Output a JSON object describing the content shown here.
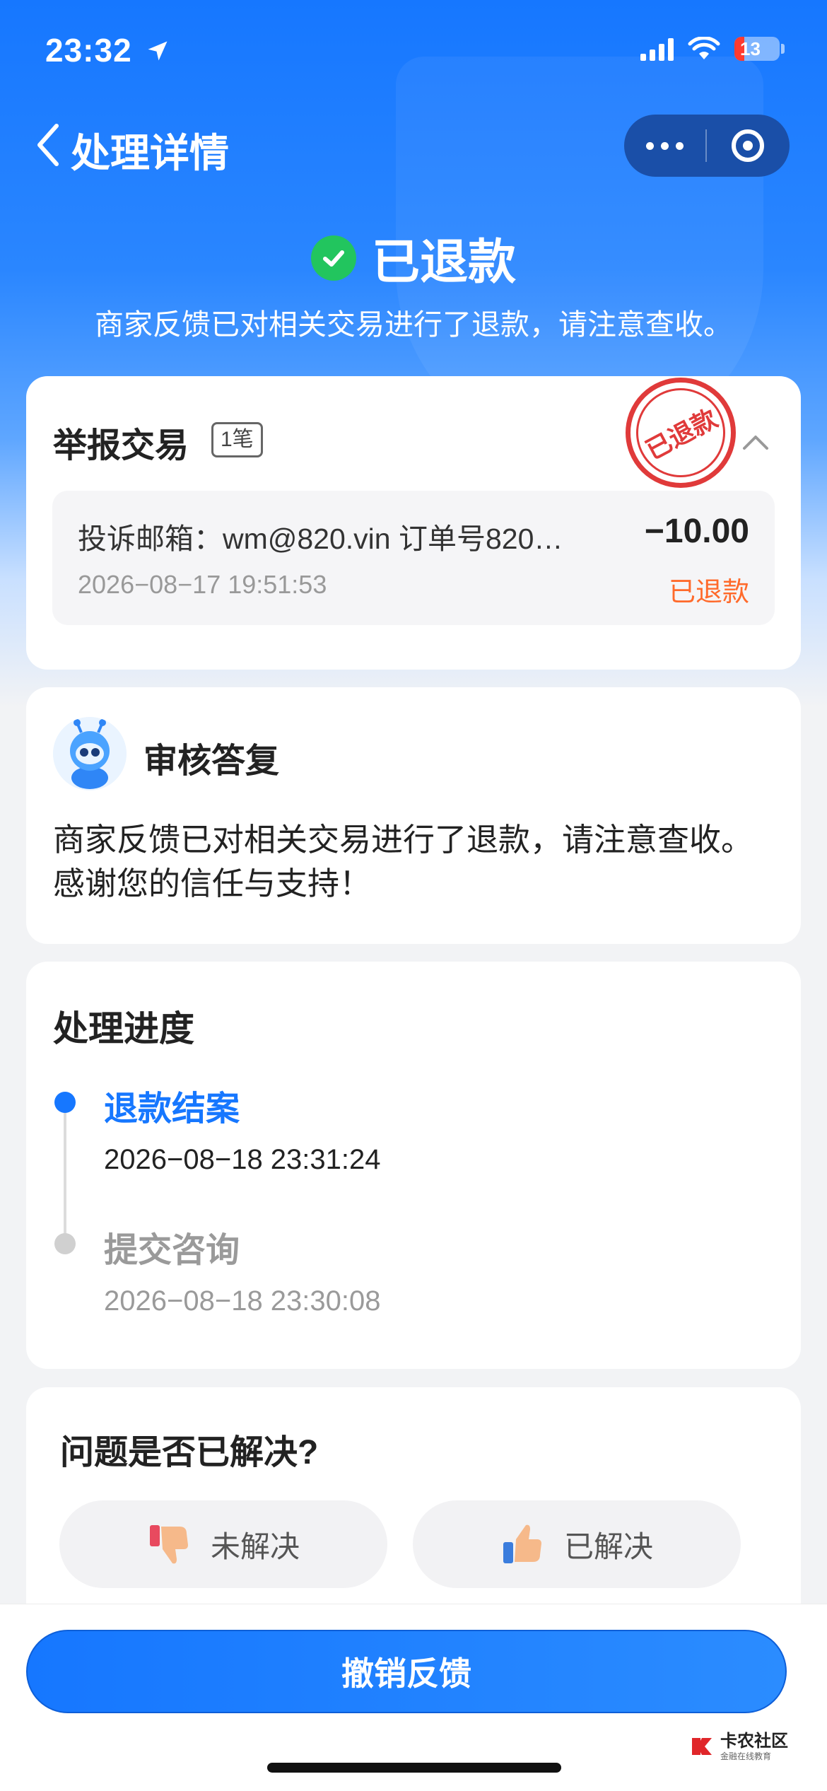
{
  "status_bar": {
    "time": "23:32",
    "battery": "13"
  },
  "nav": {
    "title": "处理详情"
  },
  "status": {
    "title": "已退款",
    "description": "商家反馈已对相关交易进行了退款，请注意查收。"
  },
  "report": {
    "title": "举报交易",
    "count_badge": "1笔",
    "stamp_text": "已退款",
    "transaction": {
      "description": "投诉邮箱：wm@820.vin 订单号820…",
      "amount": "−10.00",
      "time": "2026−08−17 19:51:53",
      "status": "已退款"
    }
  },
  "review": {
    "title": "审核答复",
    "text": "商家反馈已对相关交易进行了退款，请注意查收。感谢您的信任与支持！"
  },
  "progress": {
    "title": "处理进度",
    "steps": [
      {
        "label": "退款结案",
        "time": "2026−08−18 23:31:24"
      },
      {
        "label": "提交咨询",
        "time": "2026−08−18 23:30:08"
      }
    ]
  },
  "resolve": {
    "question": "问题是否已解决?",
    "unresolved_label": "未解决",
    "resolved_label": "已解决"
  },
  "bottom": {
    "cancel_label": "撤销反馈"
  },
  "watermark": {
    "main": "卡农社区",
    "sub": "金融在线教育"
  },
  "colors": {
    "primary": "#1677ff",
    "refund_orange": "#ff6a2b",
    "stamp_red": "#e03a3a",
    "success_green": "#22c55e"
  }
}
